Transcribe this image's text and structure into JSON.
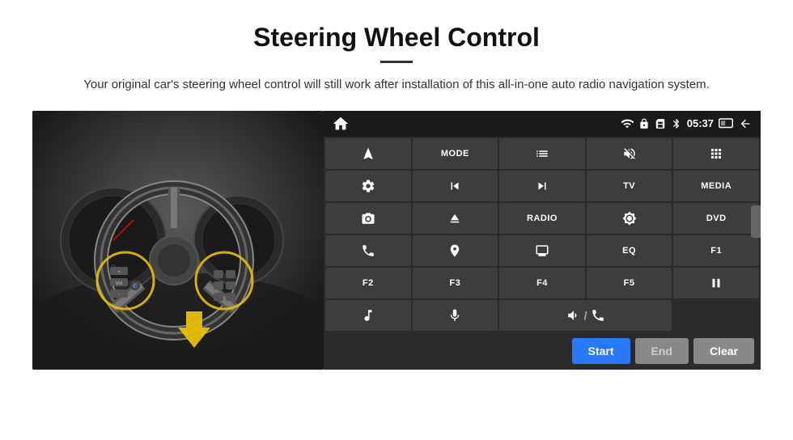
{
  "header": {
    "title": "Steering Wheel Control",
    "subtitle": "Your original car's steering wheel control will still work after installation of this all-in-one auto radio navigation system."
  },
  "status_bar": {
    "time": "05:37",
    "icons": [
      "wifi",
      "lock",
      "sim",
      "bluetooth",
      "screen-mirror",
      "back"
    ]
  },
  "buttons": [
    {
      "id": "nav",
      "type": "icon",
      "icon": "navigate"
    },
    {
      "id": "mode",
      "type": "text",
      "label": "MODE"
    },
    {
      "id": "menu-list",
      "type": "icon",
      "icon": "list"
    },
    {
      "id": "mute",
      "type": "icon",
      "icon": "mute"
    },
    {
      "id": "apps",
      "type": "icon",
      "icon": "apps"
    },
    {
      "id": "settings",
      "type": "icon",
      "icon": "settings"
    },
    {
      "id": "prev",
      "type": "icon",
      "icon": "prev"
    },
    {
      "id": "next",
      "type": "icon",
      "icon": "next"
    },
    {
      "id": "tv",
      "type": "text",
      "label": "TV"
    },
    {
      "id": "media",
      "type": "text",
      "label": "MEDIA"
    },
    {
      "id": "cam360",
      "type": "icon",
      "icon": "camera360"
    },
    {
      "id": "eject",
      "type": "icon",
      "icon": "eject"
    },
    {
      "id": "radio",
      "type": "text",
      "label": "RADIO"
    },
    {
      "id": "brightness",
      "type": "icon",
      "icon": "brightness"
    },
    {
      "id": "dvd",
      "type": "text",
      "label": "DVD"
    },
    {
      "id": "phone",
      "type": "icon",
      "icon": "phone"
    },
    {
      "id": "navi",
      "type": "icon",
      "icon": "navi"
    },
    {
      "id": "screen",
      "type": "icon",
      "icon": "screen"
    },
    {
      "id": "eq",
      "type": "text",
      "label": "EQ"
    },
    {
      "id": "f1",
      "type": "text",
      "label": "F1"
    },
    {
      "id": "f2",
      "type": "text",
      "label": "F2"
    },
    {
      "id": "f3",
      "type": "text",
      "label": "F3"
    },
    {
      "id": "f4",
      "type": "text",
      "label": "F4"
    },
    {
      "id": "f5",
      "type": "text",
      "label": "F5"
    },
    {
      "id": "playpause",
      "type": "icon",
      "icon": "playpause"
    },
    {
      "id": "music",
      "type": "icon",
      "icon": "music"
    },
    {
      "id": "mic",
      "type": "icon",
      "icon": "mic"
    },
    {
      "id": "volphone",
      "type": "icon",
      "icon": "vol-phone"
    },
    {
      "id": "empty1",
      "type": "empty"
    },
    {
      "id": "empty2",
      "type": "empty"
    }
  ],
  "action_bar": {
    "start_label": "Start",
    "end_label": "End",
    "clear_label": "Clear"
  }
}
